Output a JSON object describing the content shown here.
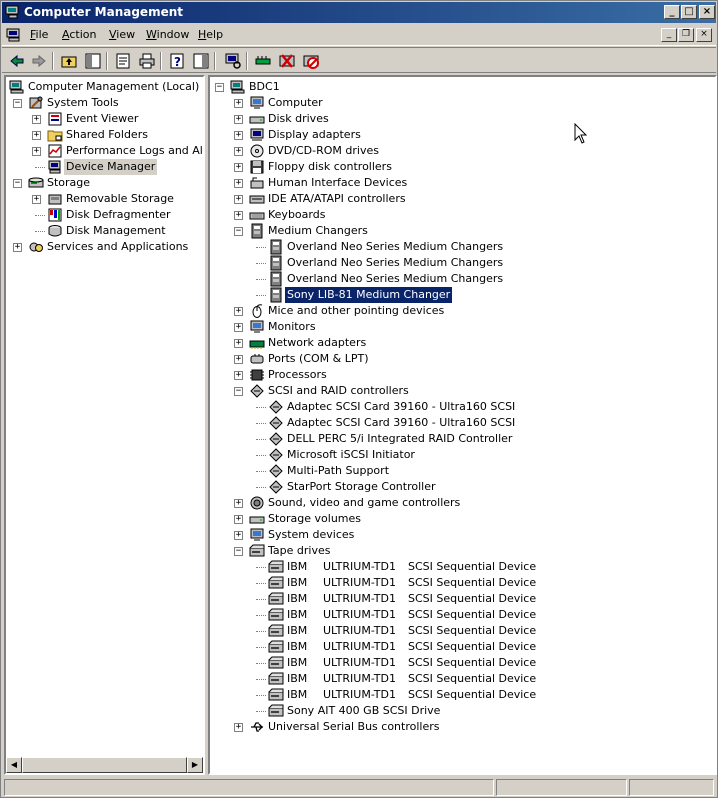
{
  "window": {
    "title": "Computer Management"
  },
  "menu": {
    "file": "File",
    "action": "Action",
    "view": "View",
    "window": "Window",
    "help": "Help"
  },
  "toolbar": {
    "icons": [
      "back-icon",
      "forward-icon",
      "up-folder-icon",
      "show-hide-tree-icon",
      "properties-icon",
      "print-icon",
      "help-icon",
      "show-hide-action-pane-icon",
      "scan-hardware-icon",
      "update-driver-icon",
      "uninstall-icon",
      "disable-icon"
    ]
  },
  "left_tree": [
    {
      "label": "Computer Management (Local)",
      "level": 0,
      "exp": "",
      "icon": "computer",
      "name": "tree-computer-management"
    },
    {
      "label": "System Tools",
      "level": 1,
      "exp": "-",
      "icon": "tools",
      "name": "tree-system-tools"
    },
    {
      "label": "Event Viewer",
      "level": 2,
      "exp": "+",
      "icon": "event",
      "name": "tree-event-viewer"
    },
    {
      "label": "Shared Folders",
      "level": 2,
      "exp": "+",
      "icon": "folder",
      "name": "tree-shared-folders"
    },
    {
      "label": "Performance Logs and Alerts",
      "level": 2,
      "exp": "+",
      "icon": "perf",
      "name": "tree-performance-logs"
    },
    {
      "label": "Device Manager",
      "level": 2,
      "exp": "",
      "icon": "devmgr",
      "name": "tree-device-manager",
      "selected": true
    },
    {
      "label": "Storage",
      "level": 1,
      "exp": "-",
      "icon": "storage",
      "name": "tree-storage"
    },
    {
      "label": "Removable Storage",
      "level": 2,
      "exp": "+",
      "icon": "removable",
      "name": "tree-removable-storage"
    },
    {
      "label": "Disk Defragmenter",
      "level": 2,
      "exp": "",
      "icon": "defrag",
      "name": "tree-disk-defragmenter"
    },
    {
      "label": "Disk Management",
      "level": 2,
      "exp": "",
      "icon": "diskmgmt",
      "name": "tree-disk-management"
    },
    {
      "label": "Services and Applications",
      "level": 1,
      "exp": "+",
      "icon": "services",
      "name": "tree-services-applications"
    }
  ],
  "right_tree": [
    {
      "label": "BDC1",
      "level": 0,
      "exp": "-",
      "icon": "computer"
    },
    {
      "label": "Computer",
      "level": 1,
      "exp": "+",
      "icon": "monitor"
    },
    {
      "label": "Disk drives",
      "level": 1,
      "exp": "+",
      "icon": "disk"
    },
    {
      "label": "Display adapters",
      "level": 1,
      "exp": "+",
      "icon": "display"
    },
    {
      "label": "DVD/CD-ROM drives",
      "level": 1,
      "exp": "+",
      "icon": "cdrom"
    },
    {
      "label": "Floppy disk controllers",
      "level": 1,
      "exp": "+",
      "icon": "floppy"
    },
    {
      "label": "Human Interface Devices",
      "level": 1,
      "exp": "+",
      "icon": "hid"
    },
    {
      "label": "IDE ATA/ATAPI controllers",
      "level": 1,
      "exp": "+",
      "icon": "ide"
    },
    {
      "label": "Keyboards",
      "level": 1,
      "exp": "+",
      "icon": "keyboard"
    },
    {
      "label": "Medium Changers",
      "level": 1,
      "exp": "-",
      "icon": "changer"
    },
    {
      "label": "Overland Neo Series Medium Changers",
      "level": 2,
      "exp": "",
      "icon": "changer"
    },
    {
      "label": "Overland Neo Series Medium Changers",
      "level": 2,
      "exp": "",
      "icon": "changer"
    },
    {
      "label": "Overland Neo Series Medium Changers",
      "level": 2,
      "exp": "",
      "icon": "changer"
    },
    {
      "label": "Sony LIB-81 Medium Changer",
      "level": 2,
      "exp": "",
      "icon": "changer",
      "selected": true
    },
    {
      "label": "Mice and other pointing devices",
      "level": 1,
      "exp": "+",
      "icon": "mouse"
    },
    {
      "label": "Monitors",
      "level": 1,
      "exp": "+",
      "icon": "monitor"
    },
    {
      "label": "Network adapters",
      "level": 1,
      "exp": "+",
      "icon": "network"
    },
    {
      "label": "Ports (COM & LPT)",
      "level": 1,
      "exp": "+",
      "icon": "port"
    },
    {
      "label": "Processors",
      "level": 1,
      "exp": "+",
      "icon": "cpu"
    },
    {
      "label": "SCSI and RAID controllers",
      "level": 1,
      "exp": "-",
      "icon": "scsi"
    },
    {
      "label": "Adaptec SCSI Card 39160 - Ultra160 SCSI",
      "level": 2,
      "exp": "",
      "icon": "scsi"
    },
    {
      "label": "Adaptec SCSI Card 39160 - Ultra160 SCSI",
      "level": 2,
      "exp": "",
      "icon": "scsi"
    },
    {
      "label": "DELL PERC 5/i Integrated RAID Controller",
      "level": 2,
      "exp": "",
      "icon": "scsi"
    },
    {
      "label": "Microsoft iSCSI Initiator",
      "level": 2,
      "exp": "",
      "icon": "scsi"
    },
    {
      "label": "Multi-Path Support",
      "level": 2,
      "exp": "",
      "icon": "scsi"
    },
    {
      "label": "StarPort Storage Controller",
      "level": 2,
      "exp": "",
      "icon": "scsi"
    },
    {
      "label": "Sound, video and game controllers",
      "level": 1,
      "exp": "+",
      "icon": "sound"
    },
    {
      "label": "Storage volumes",
      "level": 1,
      "exp": "+",
      "icon": "disk"
    },
    {
      "label": "System devices",
      "level": 1,
      "exp": "+",
      "icon": "monitor"
    },
    {
      "label": "Tape drives",
      "level": 1,
      "exp": "-",
      "icon": "tape"
    },
    {
      "label": "IBM",
      "col2": "ULTRIUM-TD1",
      "col3": "SCSI Sequential Device",
      "level": 2,
      "exp": "",
      "icon": "tape"
    },
    {
      "label": "IBM",
      "col2": "ULTRIUM-TD1",
      "col3": "SCSI Sequential Device",
      "level": 2,
      "exp": "",
      "icon": "tape"
    },
    {
      "label": "IBM",
      "col2": "ULTRIUM-TD1",
      "col3": "SCSI Sequential Device",
      "level": 2,
      "exp": "",
      "icon": "tape"
    },
    {
      "label": "IBM",
      "col2": "ULTRIUM-TD1",
      "col3": "SCSI Sequential Device",
      "level": 2,
      "exp": "",
      "icon": "tape"
    },
    {
      "label": "IBM",
      "col2": "ULTRIUM-TD1",
      "col3": "SCSI Sequential Device",
      "level": 2,
      "exp": "",
      "icon": "tape"
    },
    {
      "label": "IBM",
      "col2": "ULTRIUM-TD1",
      "col3": "SCSI Sequential Device",
      "level": 2,
      "exp": "",
      "icon": "tape"
    },
    {
      "label": "IBM",
      "col2": "ULTRIUM-TD1",
      "col3": "SCSI Sequential Device",
      "level": 2,
      "exp": "",
      "icon": "tape"
    },
    {
      "label": "IBM",
      "col2": "ULTRIUM-TD1",
      "col3": "SCSI Sequential Device",
      "level": 2,
      "exp": "",
      "icon": "tape"
    },
    {
      "label": "IBM",
      "col2": "ULTRIUM-TD1",
      "col3": "SCSI Sequential Device",
      "level": 2,
      "exp": "",
      "icon": "tape"
    },
    {
      "label": "Sony AIT 400 GB SCSI Drive",
      "level": 2,
      "exp": "",
      "icon": "tape"
    },
    {
      "label": "Universal Serial Bus controllers",
      "level": 1,
      "exp": "+",
      "icon": "usb"
    }
  ]
}
